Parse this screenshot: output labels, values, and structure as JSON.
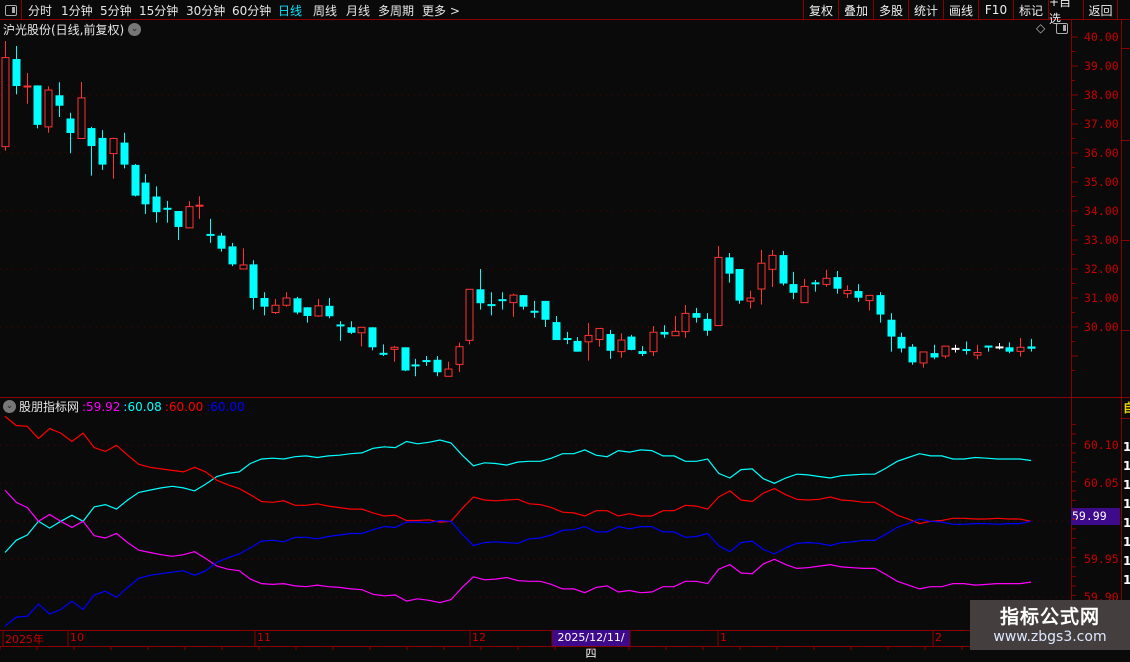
{
  "toolbar": {
    "periods": [
      "分时",
      "1分钟",
      "5分钟",
      "15分钟",
      "30分钟",
      "60分钟",
      "日线",
      "周线",
      "月线",
      "多周期",
      "更多 >"
    ],
    "active_period": "日线",
    "buttons": [
      "复权",
      "叠加",
      "多股",
      "统计",
      "画线",
      "F10",
      "标记",
      "+自选",
      "返回"
    ]
  },
  "main_chart": {
    "title": "沪光股份(日线,前复权)",
    "price_labels": [
      "40.00",
      "39.00",
      "38.00",
      "37.00",
      "36.00",
      "35.00",
      "34.00",
      "33.00",
      "32.00",
      "31.00",
      "30.00"
    ]
  },
  "indicator": {
    "name": "股朋指标网",
    "values": [
      {
        "text": ":59.92",
        "color": "#ff00ff"
      },
      {
        "text": ":60.08",
        "color": "#00ffff"
      },
      {
        "text": ":60.00",
        "color": "#ff0000"
      },
      {
        "text": ":60.00",
        "color": "#0000ff"
      }
    ],
    "axis_labels": [
      "60.10",
      "60.05",
      "59.95",
      "59.90"
    ],
    "cursor_value": "59.99"
  },
  "date_axis": {
    "labels": [
      {
        "text": "2025年"
      },
      {
        "text": "10"
      },
      {
        "text": "11"
      },
      {
        "text": "12"
      },
      {
        "text": "1"
      },
      {
        "text": "2"
      }
    ],
    "cursor_date": "2025/12/11/四"
  },
  "right_strip": {
    "digit": "1",
    "top_label": "自"
  },
  "watermark": {
    "title": "指标公式网",
    "url": "www.zbgs3.com"
  },
  "colors": {
    "up": "#ff3232",
    "down": "#00ffff",
    "flat": "#ffffff",
    "axis": "#c80000",
    "bg": "#0a0a0a"
  },
  "chart_data": [
    {
      "type": "candlestick",
      "title": "沪光股份(日线,前复权)",
      "ylim": [
        28,
        40
      ],
      "grid_every": 2,
      "fields": [
        "open",
        "high",
        "low",
        "close"
      ],
      "candles": [
        [
          36.22,
          39.86,
          36.08,
          39.29
        ],
        [
          39.24,
          39.69,
          38.02,
          38.31
        ],
        [
          38.3,
          38.76,
          37.7,
          38.31
        ],
        [
          38.33,
          38.33,
          36.85,
          36.97
        ],
        [
          36.9,
          38.3,
          36.7,
          38.17
        ],
        [
          37.99,
          38.44,
          37.24,
          37.63
        ],
        [
          37.19,
          37.39,
          35.99,
          36.69
        ],
        [
          36.5,
          38.45,
          36.5,
          37.9
        ],
        [
          36.86,
          36.9,
          35.22,
          36.24
        ],
        [
          36.52,
          36.79,
          35.42,
          35.6
        ],
        [
          35.98,
          36.53,
          35.11,
          36.5
        ],
        [
          36.36,
          36.7,
          35.47,
          35.6
        ],
        [
          35.59,
          35.62,
          34.5,
          34.53
        ],
        [
          34.98,
          35.27,
          33.9,
          34.23
        ],
        [
          34.5,
          34.85,
          33.6,
          33.96
        ],
        [
          34.11,
          34.35,
          33.6,
          34.1
        ],
        [
          34.0,
          34.0,
          33.0,
          33.45
        ],
        [
          33.42,
          34.34,
          33.4,
          34.15
        ],
        [
          34.19,
          34.51,
          33.73,
          34.2
        ],
        [
          33.21,
          33.73,
          32.9,
          33.2
        ],
        [
          33.15,
          33.25,
          32.6,
          32.7
        ],
        [
          32.78,
          32.9,
          32.1,
          32.16
        ],
        [
          32.0,
          32.71,
          32.0,
          32.14
        ],
        [
          32.16,
          32.3,
          30.6,
          31.0
        ],
        [
          31.0,
          31.2,
          30.4,
          30.7
        ],
        [
          30.5,
          30.97,
          30.45,
          30.75
        ],
        [
          30.75,
          31.2,
          30.7,
          31.0
        ],
        [
          30.99,
          31.04,
          30.44,
          30.5
        ],
        [
          30.68,
          30.68,
          30.15,
          30.38
        ],
        [
          30.38,
          30.97,
          30.35,
          30.73
        ],
        [
          30.73,
          31.0,
          30.3,
          30.37
        ],
        [
          30.09,
          30.2,
          29.52,
          30.08
        ],
        [
          29.99,
          30.2,
          29.76,
          29.8
        ],
        [
          29.8,
          29.99,
          29.33,
          29.99
        ],
        [
          29.99,
          29.99,
          29.2,
          29.3
        ],
        [
          29.11,
          29.4,
          29.0,
          29.1
        ],
        [
          29.23,
          29.35,
          28.8,
          29.3
        ],
        [
          29.3,
          29.3,
          28.48,
          28.5
        ],
        [
          28.71,
          28.9,
          28.3,
          28.7
        ],
        [
          28.86,
          29.0,
          28.66,
          28.85
        ],
        [
          28.87,
          29.0,
          28.3,
          28.44
        ],
        [
          28.3,
          28.8,
          28.3,
          28.55
        ],
        [
          28.71,
          29.46,
          28.45,
          29.32
        ],
        [
          29.54,
          31.3,
          29.4,
          31.3
        ],
        [
          31.3,
          32.0,
          30.6,
          30.82
        ],
        [
          30.79,
          31.2,
          30.4,
          30.78
        ],
        [
          30.96,
          31.2,
          30.6,
          30.95
        ],
        [
          30.84,
          31.15,
          30.35,
          31.1
        ],
        [
          31.1,
          31.1,
          30.6,
          30.7
        ],
        [
          30.56,
          30.9,
          30.32,
          30.55
        ],
        [
          30.9,
          30.9,
          30.0,
          30.25
        ],
        [
          30.17,
          30.38,
          29.55,
          29.55
        ],
        [
          29.62,
          29.83,
          29.41,
          29.61
        ],
        [
          29.52,
          29.65,
          29.15,
          29.15
        ],
        [
          29.49,
          30.14,
          28.84,
          29.71
        ],
        [
          29.57,
          29.95,
          29.32,
          29.95
        ],
        [
          29.76,
          29.9,
          28.9,
          29.18
        ],
        [
          29.15,
          29.78,
          28.94,
          29.55
        ],
        [
          29.67,
          29.73,
          29.2,
          29.21
        ],
        [
          29.17,
          29.34,
          29.0,
          29.07
        ],
        [
          29.15,
          30.03,
          29.0,
          29.82
        ],
        [
          29.83,
          30.06,
          29.63,
          29.74
        ],
        [
          29.7,
          30.38,
          29.7,
          29.85
        ],
        [
          29.84,
          30.76,
          29.63,
          30.47
        ],
        [
          30.48,
          30.66,
          30.15,
          30.32
        ],
        [
          30.28,
          30.48,
          29.7,
          29.87
        ],
        [
          30.05,
          32.79,
          30.05,
          32.4
        ],
        [
          32.4,
          32.55,
          31.53,
          31.84
        ],
        [
          32.0,
          32.0,
          30.8,
          30.91
        ],
        [
          30.89,
          31.25,
          30.64,
          31.0
        ],
        [
          31.31,
          32.66,
          30.77,
          32.2
        ],
        [
          31.99,
          32.66,
          31.38,
          32.47
        ],
        [
          32.48,
          32.62,
          31.43,
          31.5
        ],
        [
          31.48,
          31.9,
          30.96,
          31.18
        ],
        [
          30.84,
          31.66,
          30.84,
          31.4
        ],
        [
          31.54,
          31.62,
          31.22,
          31.53
        ],
        [
          31.47,
          31.97,
          31.39,
          31.68
        ],
        [
          31.72,
          31.93,
          31.15,
          31.32
        ],
        [
          31.15,
          31.44,
          31.0,
          31.26
        ],
        [
          31.24,
          31.48,
          30.87,
          31.01
        ],
        [
          30.91,
          31.09,
          30.57,
          31.09
        ],
        [
          31.1,
          31.2,
          30.15,
          30.43
        ],
        [
          30.25,
          30.48,
          29.15,
          29.67
        ],
        [
          29.66,
          29.8,
          29.12,
          29.26
        ],
        [
          29.32,
          29.41,
          28.7,
          28.78
        ],
        [
          28.76,
          29.14,
          28.6,
          29.14
        ],
        [
          29.1,
          29.39,
          28.89,
          28.95
        ],
        [
          29.0,
          29.34,
          28.92,
          29.34
        ],
        [
          29.28,
          29.39,
          29.12,
          29.28
        ],
        [
          29.24,
          29.5,
          29.05,
          29.23
        ],
        [
          29.03,
          29.39,
          28.89,
          29.12
        ],
        [
          29.36,
          29.36,
          29.15,
          29.35
        ],
        [
          29.33,
          29.45,
          29.23,
          29.33
        ],
        [
          29.3,
          29.47,
          29.1,
          29.15
        ],
        [
          29.16,
          29.62,
          28.98,
          29.3
        ],
        [
          29.33,
          29.59,
          29.15,
          29.25
        ]
      ]
    },
    {
      "type": "line",
      "title": "股朋指标网",
      "ylim": [
        59.86,
        60.14
      ],
      "grid": [
        60.1,
        60.05,
        60.0,
        59.95,
        59.9
      ],
      "series": [
        {
          "name": "cyan",
          "color": "#00ffff",
          "values": [
            59.959,
            59.975,
            59.982,
            60.0,
            59.991,
            60.0,
            60.008,
            60.0,
            60.019,
            60.022,
            60.016,
            60.028,
            60.038,
            60.041,
            60.044,
            60.046,
            60.044,
            60.04,
            60.049,
            60.059,
            60.063,
            60.065,
            60.076,
            60.082,
            60.083,
            60.082,
            60.085,
            60.086,
            60.084,
            60.086,
            60.087,
            60.089,
            60.09,
            60.096,
            60.098,
            60.097,
            60.105,
            60.102,
            60.104,
            60.107,
            60.103,
            60.087,
            60.073,
            60.077,
            60.076,
            60.074,
            60.078,
            60.079,
            60.079,
            60.083,
            60.089,
            60.089,
            60.094,
            60.087,
            60.085,
            60.093,
            60.091,
            60.094,
            60.093,
            60.086,
            60.086,
            60.079,
            60.079,
            60.082,
            60.063,
            60.057,
            60.068,
            60.069,
            60.056,
            60.05,
            60.057,
            60.062,
            60.061,
            60.059,
            60.057,
            60.06,
            60.061,
            60.062,
            60.062,
            60.07,
            60.079,
            60.084,
            60.089,
            60.086,
            60.086,
            60.082,
            60.082,
            60.084,
            60.083,
            60.082,
            60.082,
            60.082,
            60.08
          ]
        },
        {
          "name": "red",
          "color": "#ff0000",
          "values": [
            60.138,
            60.126,
            60.125,
            60.109,
            60.122,
            60.116,
            60.105,
            60.116,
            60.097,
            60.092,
            60.1,
            60.087,
            60.075,
            60.071,
            60.069,
            60.067,
            60.065,
            60.071,
            60.065,
            60.054,
            60.048,
            60.043,
            60.035,
            60.026,
            60.025,
            60.027,
            60.021,
            60.021,
            60.023,
            60.02,
            60.018,
            60.016,
            60.016,
            60.011,
            60.007,
            60.008,
            60.001,
            60.001,
            60.002,
            59.999,
            60.0,
            60.017,
            60.032,
            60.028,
            60.027,
            60.028,
            60.029,
            60.023,
            60.022,
            60.018,
            60.012,
            60.011,
            60.007,
            60.014,
            60.014,
            60.007,
            60.01,
            60.007,
            60.007,
            60.014,
            60.014,
            60.021,
            60.02,
            60.016,
            60.032,
            60.04,
            60.028,
            60.026,
            60.037,
            60.043,
            60.035,
            60.029,
            60.028,
            60.029,
            60.032,
            60.028,
            60.027,
            60.025,
            60.025,
            60.017,
            60.008,
            60.003,
            59.997,
            60.0,
            60.001,
            60.004,
            60.004,
            60.003,
            60.003,
            60.004,
            60.003,
            60.003,
            60.0
          ]
        },
        {
          "name": "magenta",
          "color": "#ff00ff",
          "mirror_of": "cyan",
          "mirror_sum": 120
        },
        {
          "name": "blue",
          "color": "#0000ff",
          "mirror_of": "red",
          "mirror_sum": 120
        }
      ]
    }
  ]
}
